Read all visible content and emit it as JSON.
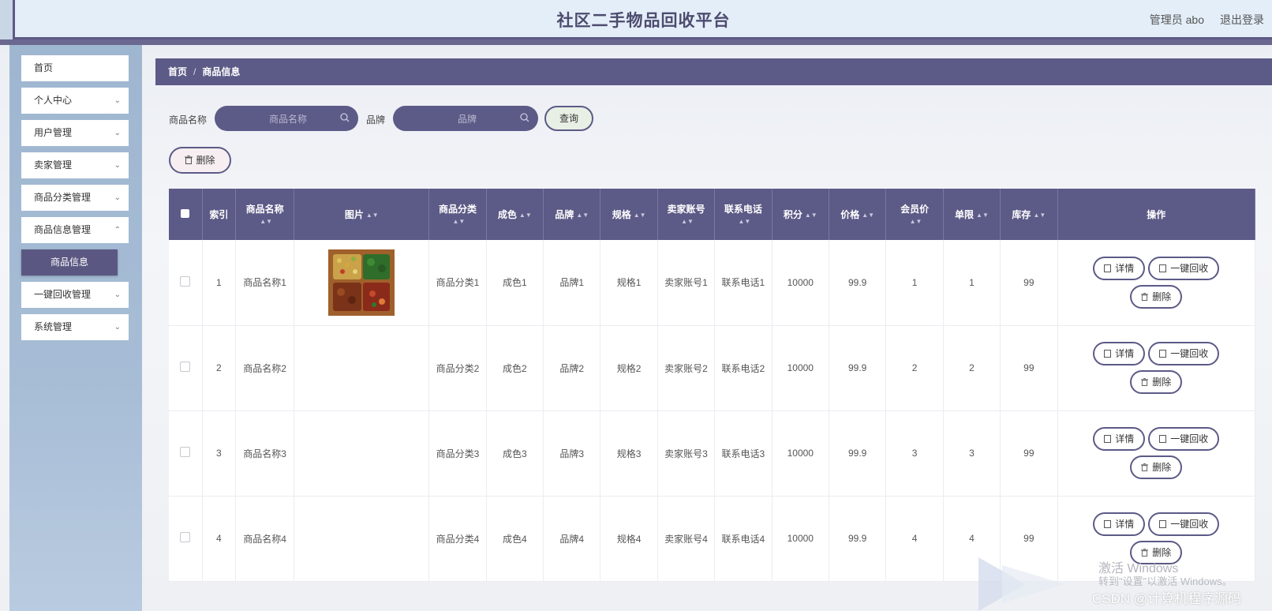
{
  "header": {
    "title": "社区二手物品回收平台",
    "admin": "管理员 abo",
    "logout": "退出登录"
  },
  "sidebar": {
    "items": [
      {
        "label": "首页"
      },
      {
        "label": "个人中心"
      },
      {
        "label": "用户管理"
      },
      {
        "label": "卖家管理"
      },
      {
        "label": "商品分类管理"
      },
      {
        "label": "商品信息管理"
      },
      {
        "label": "一键回收管理"
      },
      {
        "label": "系统管理"
      }
    ],
    "active_sub": "商品信息"
  },
  "breadcrumb": {
    "home": "首页",
    "sep": "/",
    "current": "商品信息"
  },
  "search": {
    "name_label": "商品名称",
    "name_placeholder": "商品名称",
    "brand_label": "品牌",
    "brand_placeholder": "品牌",
    "query_button": "查询",
    "delete_button": "删除"
  },
  "table": {
    "columns": [
      "索引",
      "商品名称",
      "图片",
      "商品分类",
      "成色",
      "品牌",
      "规格",
      "卖家账号",
      "联系电话",
      "积分",
      "价格",
      "会员价",
      "单限",
      "库存",
      "操作"
    ],
    "rows": [
      {
        "index": "1",
        "name": "商品名称1",
        "category": "商品分类1",
        "condition": "成色1",
        "brand": "品牌1",
        "spec": "规格1",
        "seller": "卖家账号1",
        "phone": "联系电话1",
        "points": "10000",
        "price": "99.9",
        "member_price": "1",
        "limit": "1",
        "stock": "99",
        "has_image": true
      },
      {
        "index": "2",
        "name": "商品名称2",
        "category": "商品分类2",
        "condition": "成色2",
        "brand": "品牌2",
        "spec": "规格2",
        "seller": "卖家账号2",
        "phone": "联系电话2",
        "points": "10000",
        "price": "99.9",
        "member_price": "2",
        "limit": "2",
        "stock": "99",
        "has_image": false
      },
      {
        "index": "3",
        "name": "商品名称3",
        "category": "商品分类3",
        "condition": "成色3",
        "brand": "品牌3",
        "spec": "规格3",
        "seller": "卖家账号3",
        "phone": "联系电话3",
        "points": "10000",
        "price": "99.9",
        "member_price": "3",
        "limit": "3",
        "stock": "99",
        "has_image": false
      },
      {
        "index": "4",
        "name": "商品名称4",
        "category": "商品分类4",
        "condition": "成色4",
        "brand": "品牌4",
        "spec": "规格4",
        "seller": "卖家账号4",
        "phone": "联系电话4",
        "points": "10000",
        "price": "99.9",
        "member_price": "4",
        "limit": "4",
        "stock": "99",
        "has_image": false
      }
    ],
    "actions": {
      "detail": "详情",
      "recycle": "一键回收",
      "delete": "删除"
    }
  },
  "watermark": {
    "line1": "激活 Windows",
    "line2": "转到\"设置\"以激活 Windows。",
    "csdn": "CSDN @计算机程序源码"
  },
  "colors": {
    "primary": "#5c5a86",
    "sidebar": "#a7bdd6"
  }
}
